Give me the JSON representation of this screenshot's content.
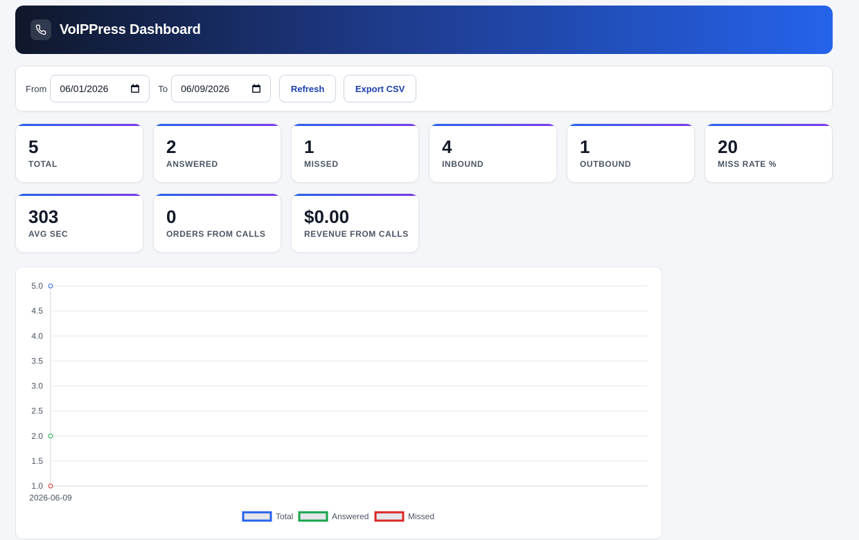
{
  "header": {
    "title": "VoIPPress Dashboard",
    "icon": "phone-icon"
  },
  "filters": {
    "from_label": "From",
    "from_value": "06/01/2026",
    "to_label": "To",
    "to_value": "06/09/2026",
    "refresh_label": "Refresh",
    "export_label": "Export CSV"
  },
  "stats": [
    {
      "value": "5",
      "label": "TOTAL"
    },
    {
      "value": "2",
      "label": "ANSWERED"
    },
    {
      "value": "1",
      "label": "MISSED"
    },
    {
      "value": "4",
      "label": "INBOUND"
    },
    {
      "value": "1",
      "label": "OUTBOUND"
    },
    {
      "value": "20",
      "label": "MISS RATE %"
    },
    {
      "value": "303",
      "label": "AVG SEC"
    },
    {
      "value": "0",
      "label": "ORDERS FROM CALLS"
    },
    {
      "value": "$0.00",
      "label": "REVENUE FROM CALLS"
    }
  ],
  "colors": {
    "header_start": "#0f172a",
    "header_end": "#2563eb",
    "accent": "#1e40af",
    "total": "#2563eb",
    "answered": "#16a34a",
    "missed": "#dc2626"
  },
  "chart_data": {
    "type": "line",
    "x": [
      "2026-06-09"
    ],
    "series": [
      {
        "name": "Total",
        "values": [
          5
        ],
        "color": "#2563eb"
      },
      {
        "name": "Answered",
        "values": [
          2
        ],
        "color": "#16a34a"
      },
      {
        "name": "Missed",
        "values": [
          1
        ],
        "color": "#dc2626"
      }
    ],
    "y_ticks": [
      "1.0",
      "1.5",
      "2.0",
      "2.5",
      "3.0",
      "3.5",
      "4.0",
      "4.5",
      "5.0"
    ],
    "ylim": [
      1.0,
      5.0
    ],
    "grid": true,
    "legend": "bottom-center"
  }
}
